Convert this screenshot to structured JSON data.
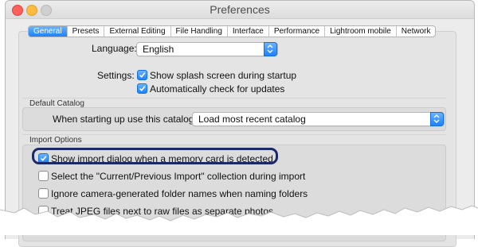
{
  "window": {
    "title": "Preferences"
  },
  "tabs": [
    {
      "label": "General",
      "active": true
    },
    {
      "label": "Presets",
      "active": false
    },
    {
      "label": "External Editing",
      "active": false
    },
    {
      "label": "File Handling",
      "active": false
    },
    {
      "label": "Interface",
      "active": false
    },
    {
      "label": "Performance",
      "active": false
    },
    {
      "label": "Lightroom mobile",
      "active": false
    },
    {
      "label": "Network",
      "active": false
    }
  ],
  "language": {
    "label": "Language:",
    "value": "English"
  },
  "settings": {
    "label": "Settings:",
    "options": [
      {
        "label": "Show splash screen during startup",
        "checked": true
      },
      {
        "label": "Automatically check for updates",
        "checked": true
      }
    ]
  },
  "default_catalog": {
    "heading": "Default Catalog",
    "label": "When starting up use this catalog:",
    "value": "Load most recent catalog"
  },
  "import_options": {
    "heading": "Import Options",
    "options": [
      {
        "label": "Show import dialog when a memory card is detected",
        "checked": true
      },
      {
        "label": "Select the \"Current/Previous Import\" collection during import",
        "checked": false
      },
      {
        "label": "Ignore camera-generated folder names when naming folders",
        "checked": false
      },
      {
        "label": "Treat JPEG files next to raw files as separate photos",
        "checked": false
      }
    ]
  },
  "colors": {
    "accent": "#1a82fb",
    "highlight_ring": "#1b2a66"
  }
}
